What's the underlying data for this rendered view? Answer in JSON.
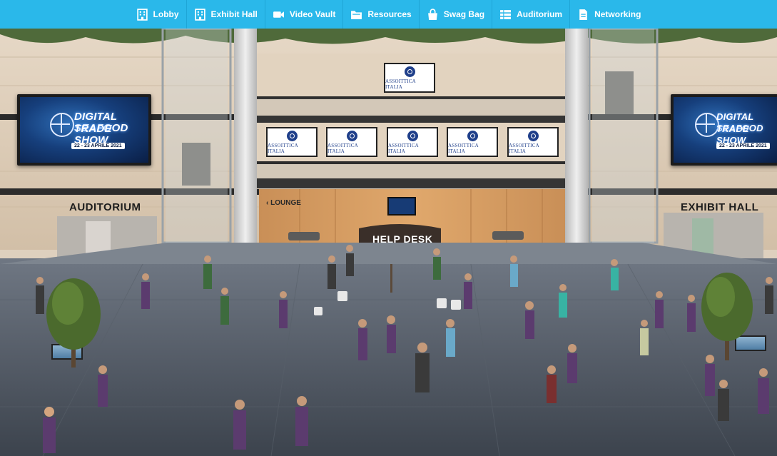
{
  "nav": {
    "items": [
      {
        "label": "Lobby",
        "icon": "building-icon"
      },
      {
        "label": "Exhibit Hall",
        "icon": "building-icon"
      },
      {
        "label": "Video Vault",
        "icon": "video-camera-icon"
      },
      {
        "label": "Resources",
        "icon": "folder-icon"
      },
      {
        "label": "Swag Bag",
        "icon": "shopping-bag-icon"
      },
      {
        "label": "Auditorium",
        "icon": "table-list-icon"
      },
      {
        "label": "Networking",
        "icon": "document-icon"
      }
    ]
  },
  "scene": {
    "billboard_left": {
      "title_line1": "DIGITAL SEAFOOD",
      "title_line2": "TRADE SHOW",
      "dates": "22 - 23 APRILE 2021"
    },
    "billboard_right": {
      "title_line1": "DIGITAL SEAFOOD",
      "title_line2": "TRADE SHOW",
      "dates": "22 - 23 APRILE 2021"
    },
    "sponsor_text": "ASSOITTICA ITALIA",
    "auditorium_sign": "AUDITORIUM",
    "exhibit_hall_sign": "EXHIBIT HALL",
    "lounge_sign": "‹ LOUNGE",
    "help_desk_sign": "HELP DESK"
  },
  "colors": {
    "nav_background": "#2ab8ea",
    "nav_text": "#ffffff"
  }
}
